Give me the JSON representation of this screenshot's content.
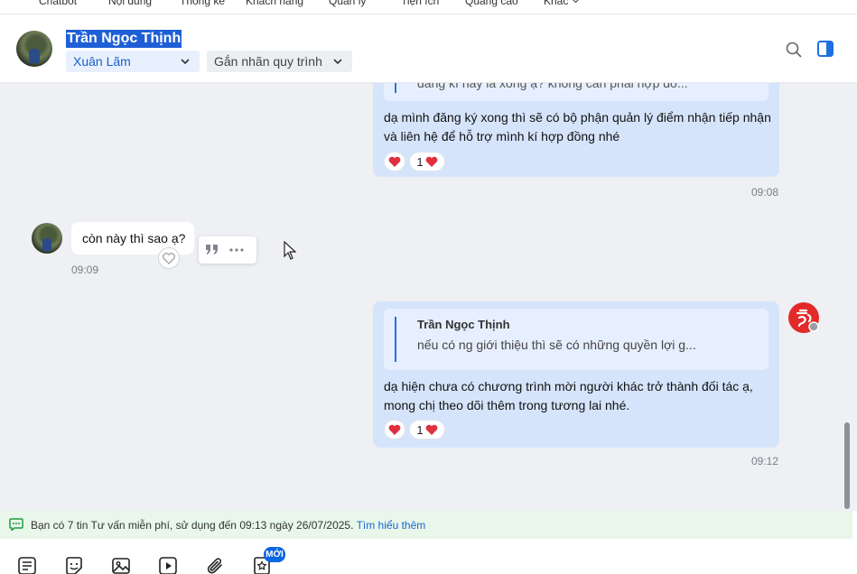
{
  "topnav": {
    "items": [
      "Chatbot",
      "Nội dung",
      "Thống kê",
      "Khách hàng",
      "Quản lý",
      "Tiện ích",
      "Quảng cáo",
      "Khác"
    ]
  },
  "header": {
    "contact_name": "Trần Ngọc Thịnh",
    "assignee": "Xuân Lãm",
    "tag_label": "Gắn nhãn quy trình",
    "search_icon": "search-icon",
    "panel_icon": "side-panel-icon"
  },
  "messages": {
    "m1": {
      "quote_text": "đăng kí này là xong ạ?  không cần phải hợp đồ...",
      "text_line1": "dạ mình đăng ký xong thì sẽ có bộ phận quản lý điểm nhận tiếp nhận",
      "text_line2": "và liên hệ để hỗ trợ mình kí hợp đồng nhé",
      "reaction_count": "1",
      "time": "09:08"
    },
    "m2": {
      "text": "còn này thì sao ạ?",
      "time": "09:09"
    },
    "m3": {
      "quote_name": "Trần Ngọc Thịnh",
      "quote_text": "nếu có ng giới thiệu thì sẽ có những quyền lợi g...",
      "text_line1": "dạ hiện chưa có chương trình mời người khác trở thành đối tác ạ,",
      "text_line2": "mong chị theo dõi thêm trong tương lai nhé.",
      "reaction_count": "1",
      "time": "09:12"
    }
  },
  "notice": {
    "text": "Bạn có 7 tin Tư vấn miễn phí, sử dụng đến 09:13 ngày 26/07/2025.",
    "link": "Tìm hiểu thêm"
  },
  "toolbar": {
    "new_badge": "MỚI"
  },
  "colors": {
    "accent": "#1f5fd6",
    "bubble_me": "#d6e4fb",
    "notice_bg": "#e8f7ea",
    "brand": "#e22a2a"
  }
}
